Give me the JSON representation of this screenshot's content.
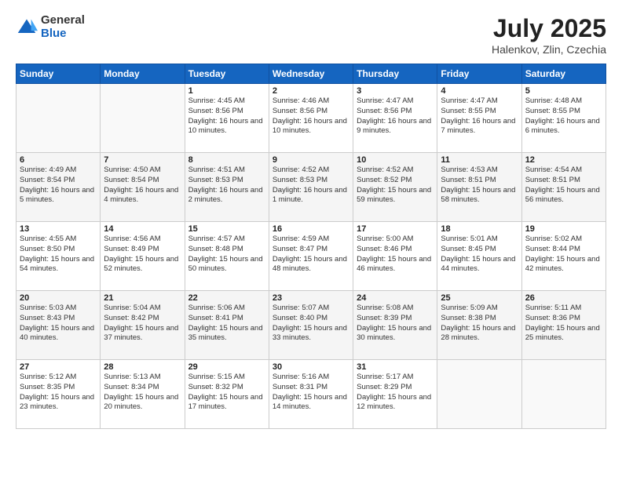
{
  "header": {
    "logo_general": "General",
    "logo_blue": "Blue",
    "title": "July 2025",
    "subtitle": "Halenkov, Zlin, Czechia"
  },
  "weekdays": [
    "Sunday",
    "Monday",
    "Tuesday",
    "Wednesday",
    "Thursday",
    "Friday",
    "Saturday"
  ],
  "weeks": [
    [
      {
        "day": "",
        "detail": ""
      },
      {
        "day": "",
        "detail": ""
      },
      {
        "day": "1",
        "detail": "Sunrise: 4:45 AM\nSunset: 8:56 PM\nDaylight: 16 hours and 10 minutes."
      },
      {
        "day": "2",
        "detail": "Sunrise: 4:46 AM\nSunset: 8:56 PM\nDaylight: 16 hours and 10 minutes."
      },
      {
        "day": "3",
        "detail": "Sunrise: 4:47 AM\nSunset: 8:56 PM\nDaylight: 16 hours and 9 minutes."
      },
      {
        "day": "4",
        "detail": "Sunrise: 4:47 AM\nSunset: 8:55 PM\nDaylight: 16 hours and 7 minutes."
      },
      {
        "day": "5",
        "detail": "Sunrise: 4:48 AM\nSunset: 8:55 PM\nDaylight: 16 hours and 6 minutes."
      }
    ],
    [
      {
        "day": "6",
        "detail": "Sunrise: 4:49 AM\nSunset: 8:54 PM\nDaylight: 16 hours and 5 minutes."
      },
      {
        "day": "7",
        "detail": "Sunrise: 4:50 AM\nSunset: 8:54 PM\nDaylight: 16 hours and 4 minutes."
      },
      {
        "day": "8",
        "detail": "Sunrise: 4:51 AM\nSunset: 8:53 PM\nDaylight: 16 hours and 2 minutes."
      },
      {
        "day": "9",
        "detail": "Sunrise: 4:52 AM\nSunset: 8:53 PM\nDaylight: 16 hours and 1 minute."
      },
      {
        "day": "10",
        "detail": "Sunrise: 4:52 AM\nSunset: 8:52 PM\nDaylight: 15 hours and 59 minutes."
      },
      {
        "day": "11",
        "detail": "Sunrise: 4:53 AM\nSunset: 8:51 PM\nDaylight: 15 hours and 58 minutes."
      },
      {
        "day": "12",
        "detail": "Sunrise: 4:54 AM\nSunset: 8:51 PM\nDaylight: 15 hours and 56 minutes."
      }
    ],
    [
      {
        "day": "13",
        "detail": "Sunrise: 4:55 AM\nSunset: 8:50 PM\nDaylight: 15 hours and 54 minutes."
      },
      {
        "day": "14",
        "detail": "Sunrise: 4:56 AM\nSunset: 8:49 PM\nDaylight: 15 hours and 52 minutes."
      },
      {
        "day": "15",
        "detail": "Sunrise: 4:57 AM\nSunset: 8:48 PM\nDaylight: 15 hours and 50 minutes."
      },
      {
        "day": "16",
        "detail": "Sunrise: 4:59 AM\nSunset: 8:47 PM\nDaylight: 15 hours and 48 minutes."
      },
      {
        "day": "17",
        "detail": "Sunrise: 5:00 AM\nSunset: 8:46 PM\nDaylight: 15 hours and 46 minutes."
      },
      {
        "day": "18",
        "detail": "Sunrise: 5:01 AM\nSunset: 8:45 PM\nDaylight: 15 hours and 44 minutes."
      },
      {
        "day": "19",
        "detail": "Sunrise: 5:02 AM\nSunset: 8:44 PM\nDaylight: 15 hours and 42 minutes."
      }
    ],
    [
      {
        "day": "20",
        "detail": "Sunrise: 5:03 AM\nSunset: 8:43 PM\nDaylight: 15 hours and 40 minutes."
      },
      {
        "day": "21",
        "detail": "Sunrise: 5:04 AM\nSunset: 8:42 PM\nDaylight: 15 hours and 37 minutes."
      },
      {
        "day": "22",
        "detail": "Sunrise: 5:06 AM\nSunset: 8:41 PM\nDaylight: 15 hours and 35 minutes."
      },
      {
        "day": "23",
        "detail": "Sunrise: 5:07 AM\nSunset: 8:40 PM\nDaylight: 15 hours and 33 minutes."
      },
      {
        "day": "24",
        "detail": "Sunrise: 5:08 AM\nSunset: 8:39 PM\nDaylight: 15 hours and 30 minutes."
      },
      {
        "day": "25",
        "detail": "Sunrise: 5:09 AM\nSunset: 8:38 PM\nDaylight: 15 hours and 28 minutes."
      },
      {
        "day": "26",
        "detail": "Sunrise: 5:11 AM\nSunset: 8:36 PM\nDaylight: 15 hours and 25 minutes."
      }
    ],
    [
      {
        "day": "27",
        "detail": "Sunrise: 5:12 AM\nSunset: 8:35 PM\nDaylight: 15 hours and 23 minutes."
      },
      {
        "day": "28",
        "detail": "Sunrise: 5:13 AM\nSunset: 8:34 PM\nDaylight: 15 hours and 20 minutes."
      },
      {
        "day": "29",
        "detail": "Sunrise: 5:15 AM\nSunset: 8:32 PM\nDaylight: 15 hours and 17 minutes."
      },
      {
        "day": "30",
        "detail": "Sunrise: 5:16 AM\nSunset: 8:31 PM\nDaylight: 15 hours and 14 minutes."
      },
      {
        "day": "31",
        "detail": "Sunrise: 5:17 AM\nSunset: 8:29 PM\nDaylight: 15 hours and 12 minutes."
      },
      {
        "day": "",
        "detail": ""
      },
      {
        "day": "",
        "detail": ""
      }
    ]
  ]
}
